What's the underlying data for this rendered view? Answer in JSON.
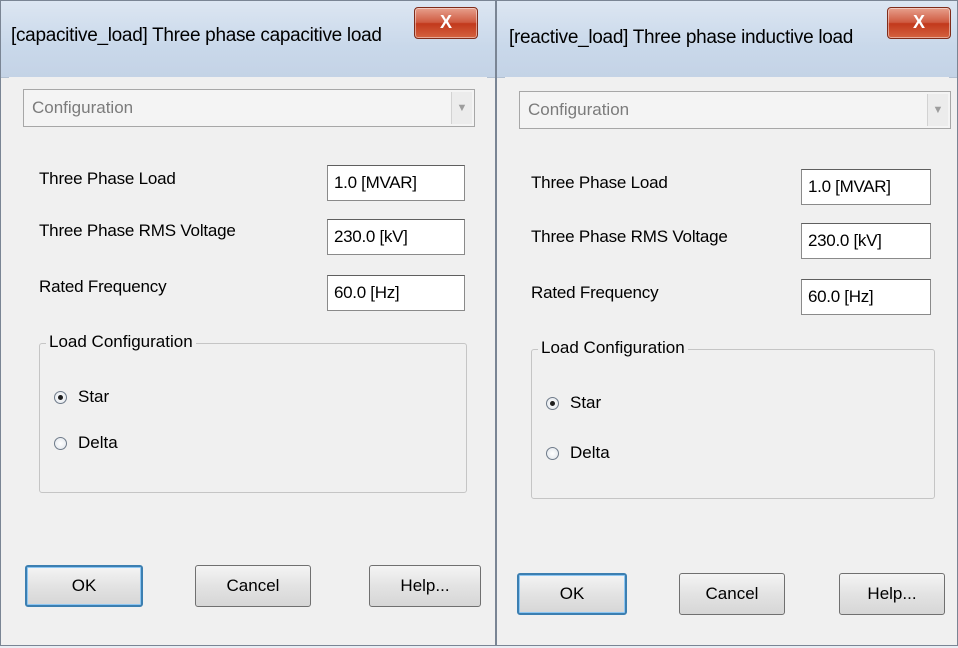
{
  "dialogs": [
    {
      "title": "[capacitive_load] Three phase capacitive load",
      "close_label": "X",
      "config_dropdown": "Configuration",
      "params": [
        {
          "label": "Three Phase Load",
          "value": "1.0 [MVAR]"
        },
        {
          "label": "Three Phase RMS Voltage",
          "value": "230.0 [kV]"
        },
        {
          "label": "Rated Frequency",
          "value": "60.0 [Hz]"
        }
      ],
      "group_label": "Load Configuration",
      "radios": [
        {
          "label": "Star",
          "checked": true
        },
        {
          "label": "Delta",
          "checked": false
        }
      ],
      "buttons": {
        "ok": "OK",
        "cancel": "Cancel",
        "help": "Help..."
      }
    },
    {
      "title": "[reactive_load] Three phase inductive load",
      "close_label": "X",
      "config_dropdown": "Configuration",
      "params": [
        {
          "label": "Three Phase Load",
          "value": "1.0 [MVAR]"
        },
        {
          "label": "Three Phase RMS Voltage",
          "value": "230.0 [kV]"
        },
        {
          "label": "Rated Frequency",
          "value": "60.0 [Hz]"
        }
      ],
      "group_label": "Load Configuration",
      "radios": [
        {
          "label": "Star",
          "checked": true
        },
        {
          "label": "Delta",
          "checked": false
        }
      ],
      "buttons": {
        "ok": "OK",
        "cancel": "Cancel",
        "help": "Help..."
      }
    }
  ]
}
